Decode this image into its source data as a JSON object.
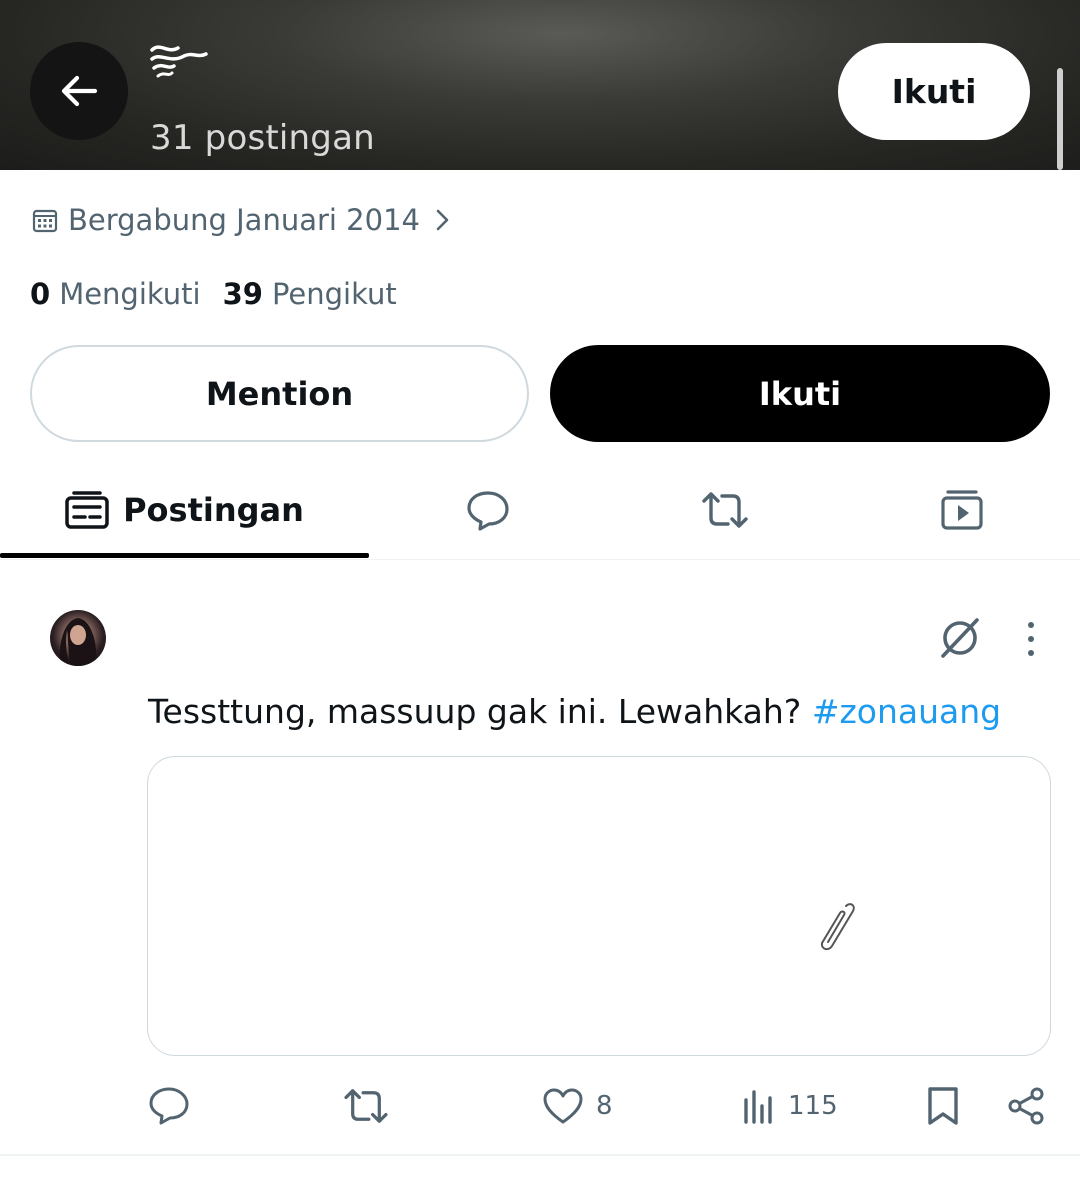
{
  "header": {
    "post_count": "31 postingan",
    "follow_label": "Ikuti",
    "back_icon": "arrow-left-icon",
    "logo_icon": "wave-glyph-icon"
  },
  "profile": {
    "joined": "Bergabung Januari 2014",
    "following_count": "0",
    "following_label": "Mengikuti",
    "followers_count": "39",
    "followers_label": "Pengikut"
  },
  "actions": {
    "mention_label": "Mention",
    "follow_label": "Ikuti"
  },
  "tabs": [
    {
      "label": "Postingan",
      "icon": "posts-icon",
      "active": true
    },
    {
      "label": "",
      "icon": "reply-bubble-icon",
      "active": false
    },
    {
      "label": "",
      "icon": "repost-icon",
      "active": false
    },
    {
      "label": "",
      "icon": "media-icon",
      "active": false
    }
  ],
  "post": {
    "text": "Tessttung, massuup gak ini. Lewahkah?",
    "hashtag": "#zonauang",
    "media_icon": "paperclip-icon",
    "reply_count": "",
    "repost_count": "",
    "like_count": "8",
    "view_count": "115"
  },
  "colors": {
    "accent": "#1d9bf0",
    "text_primary": "#0f1419",
    "text_secondary": "#536471",
    "border": "#cfd9de"
  }
}
